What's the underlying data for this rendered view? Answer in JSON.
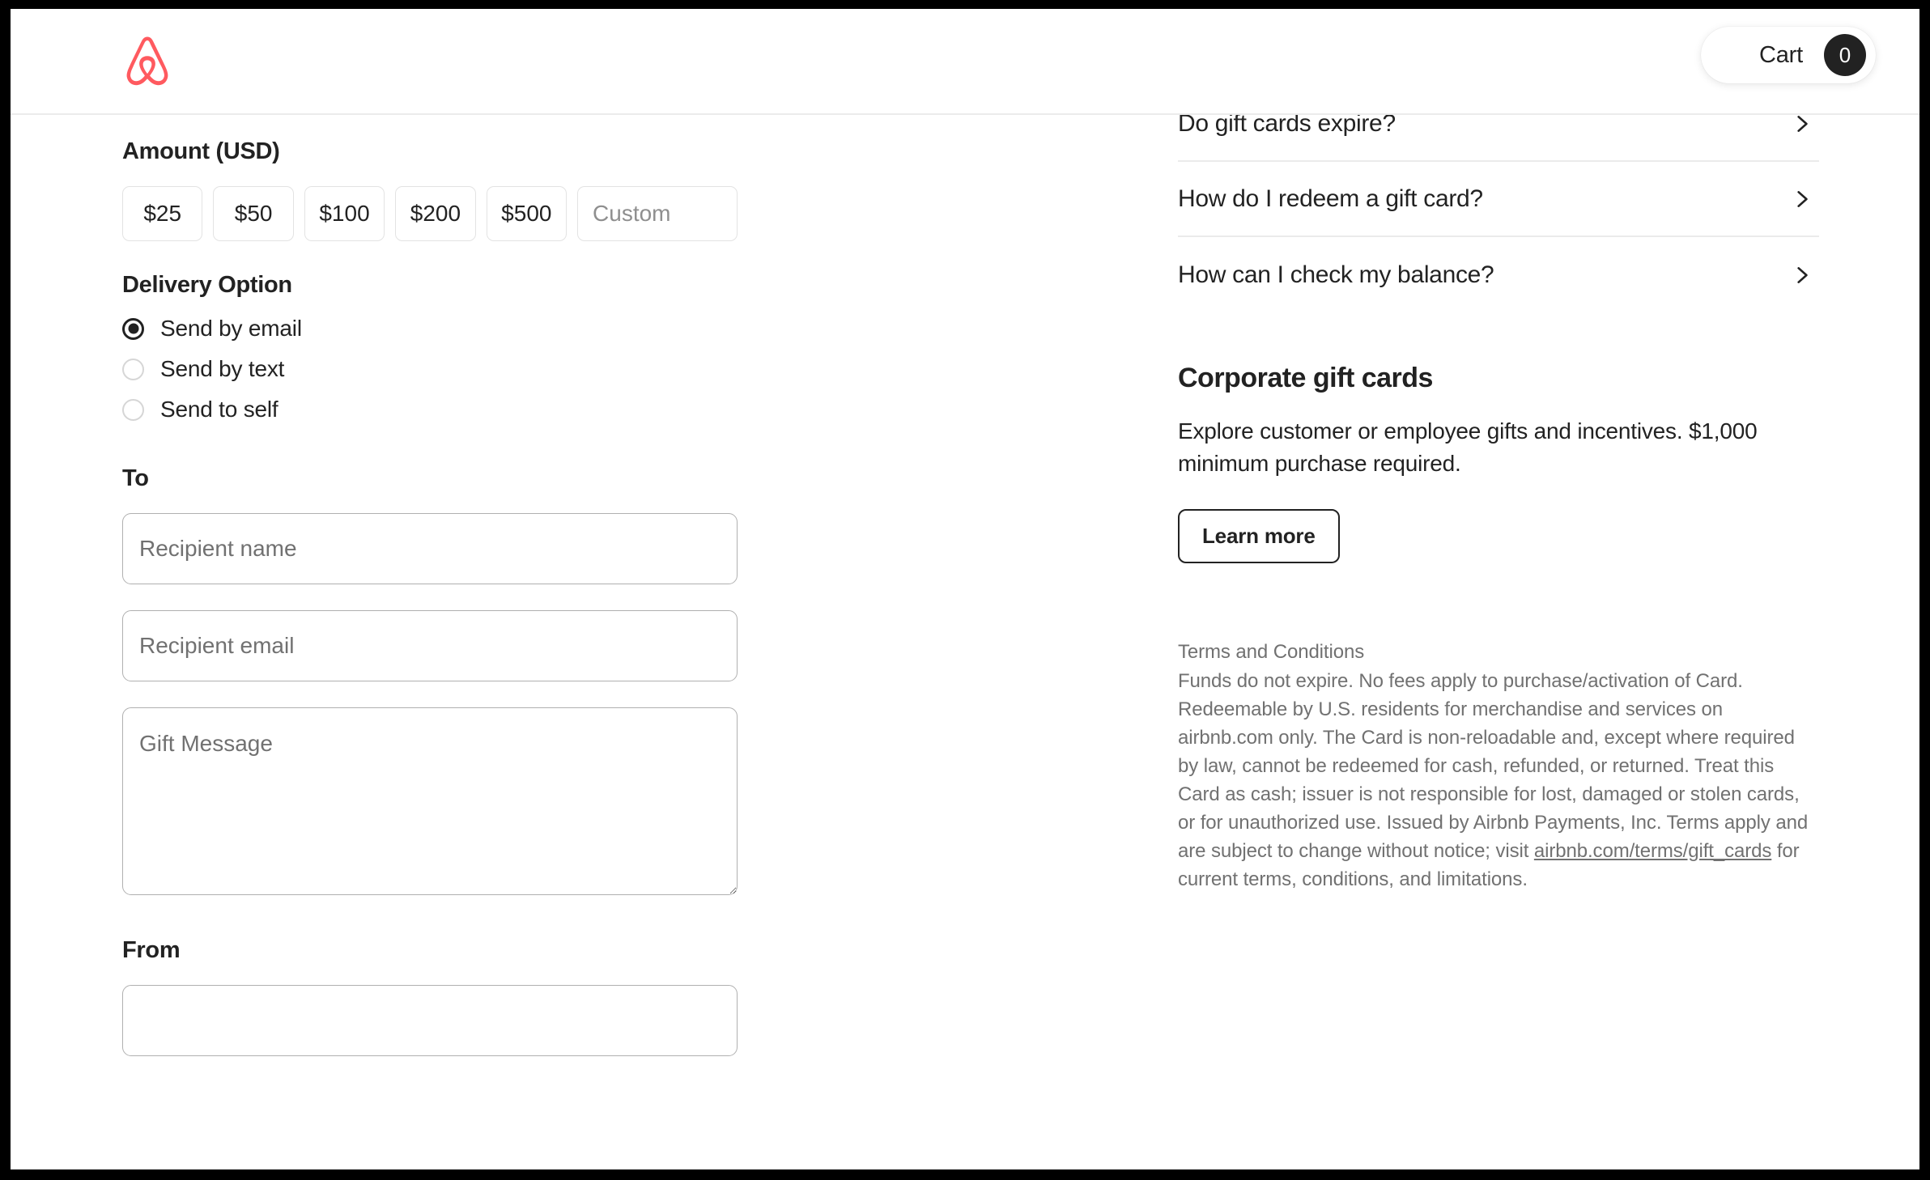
{
  "header": {
    "logo_name": "airbnb-logo",
    "logo_color": "#FF5A5F",
    "cart_label": "Cart",
    "cart_count": "0"
  },
  "form": {
    "amount_label": "Amount (USD)",
    "amounts": [
      {
        "label": "$25"
      },
      {
        "label": "$50"
      },
      {
        "label": "$100"
      },
      {
        "label": "$200"
      },
      {
        "label": "$500"
      }
    ],
    "custom_amount": {
      "placeholder": "Custom",
      "value": ""
    },
    "delivery_label": "Delivery Option",
    "delivery_options": [
      {
        "label": "Send by email",
        "selected": true
      },
      {
        "label": "Send by text",
        "selected": false
      },
      {
        "label": "Send to self",
        "selected": false
      }
    ],
    "to_label": "To",
    "recipient_name": {
      "placeholder": "Recipient name",
      "value": ""
    },
    "recipient_email": {
      "placeholder": "Recipient email",
      "value": ""
    },
    "gift_message": {
      "placeholder": "Gift Message",
      "value": ""
    },
    "from_label": "From",
    "from_field": {
      "placeholder": "",
      "value": ""
    }
  },
  "faq": {
    "items": [
      {
        "question": "Do gift cards expire?"
      },
      {
        "question": "How do I redeem a gift card?"
      },
      {
        "question": "How can I check my balance?"
      }
    ]
  },
  "corporate": {
    "title": "Corporate gift cards",
    "description": "Explore customer or employee gifts and incentives. $1,000 minimum purchase required.",
    "button_label": "Learn more"
  },
  "terms": {
    "title": "Terms and Conditions",
    "body_before_link": "Funds do not expire. No fees apply to purchase/activation of Card. Redeemable by U.S. residents for merchandise and services on airbnb.com only. The Card is non-reloadable and, except where required by law, cannot be redeemed for cash, refunded, or returned. Treat this Card as cash; issuer is not responsible for lost, damaged or stolen cards, or for unauthorized use. Issued by Airbnb Payments, Inc. Terms apply and are subject to change without notice; visit ",
    "link_text": "airbnb.com/terms/gift_cards",
    "body_after_link": " for current terms, conditions, and limitations."
  }
}
